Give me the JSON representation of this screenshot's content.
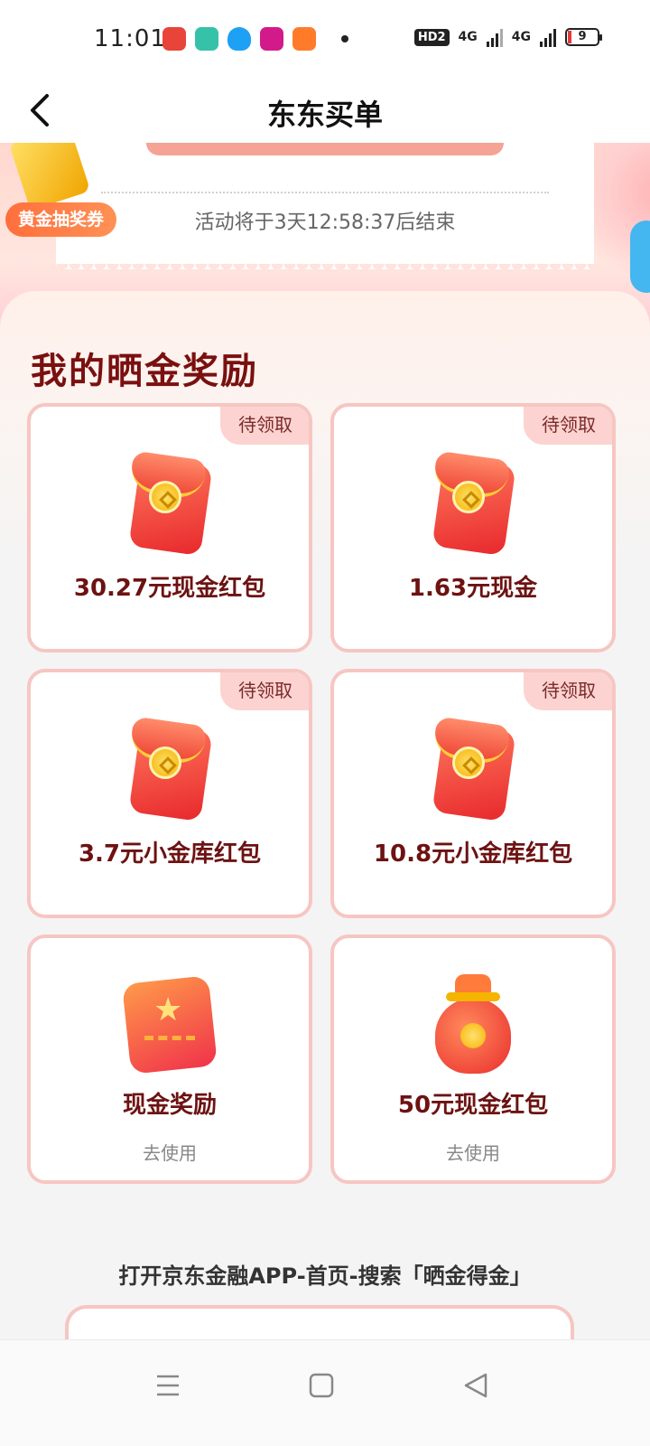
{
  "status_bar": {
    "time": "11:01",
    "hd": "HD2",
    "signal_1": "4G",
    "signal_2": "4G",
    "battery": "9"
  },
  "header": {
    "title": "东东买单"
  },
  "banner": {
    "countdown": "活动将于3天12:58:37后结束",
    "lottery_badge": "黄金抽奖券"
  },
  "rewards": {
    "title": "我的晒金奖励",
    "cards": [
      {
        "badge": "待领取",
        "label": "30.27元现金红包",
        "icon": "red-packet-icon"
      },
      {
        "badge": "待领取",
        "label": "1.63元现金",
        "icon": "red-packet-icon"
      },
      {
        "badge": "待领取",
        "label": "3.7元小金库红包",
        "icon": "red-packet-icon"
      },
      {
        "badge": "待领取",
        "label": "10.8元小金库红包",
        "icon": "red-packet-icon"
      },
      {
        "label": "现金奖励",
        "sub": "去使用",
        "icon": "coupon-icon"
      },
      {
        "label": "50元现金红包",
        "sub": "去使用",
        "icon": "money-bag-icon"
      }
    ]
  },
  "hint": "打开京东金融APP-首页-搜索「晒金得金」",
  "colors": {
    "title_red": "#7a1010",
    "card_border": "#f7c6c2",
    "badge_bg": "#fcd3d0",
    "lottery_orange": "#ff6f3c"
  }
}
